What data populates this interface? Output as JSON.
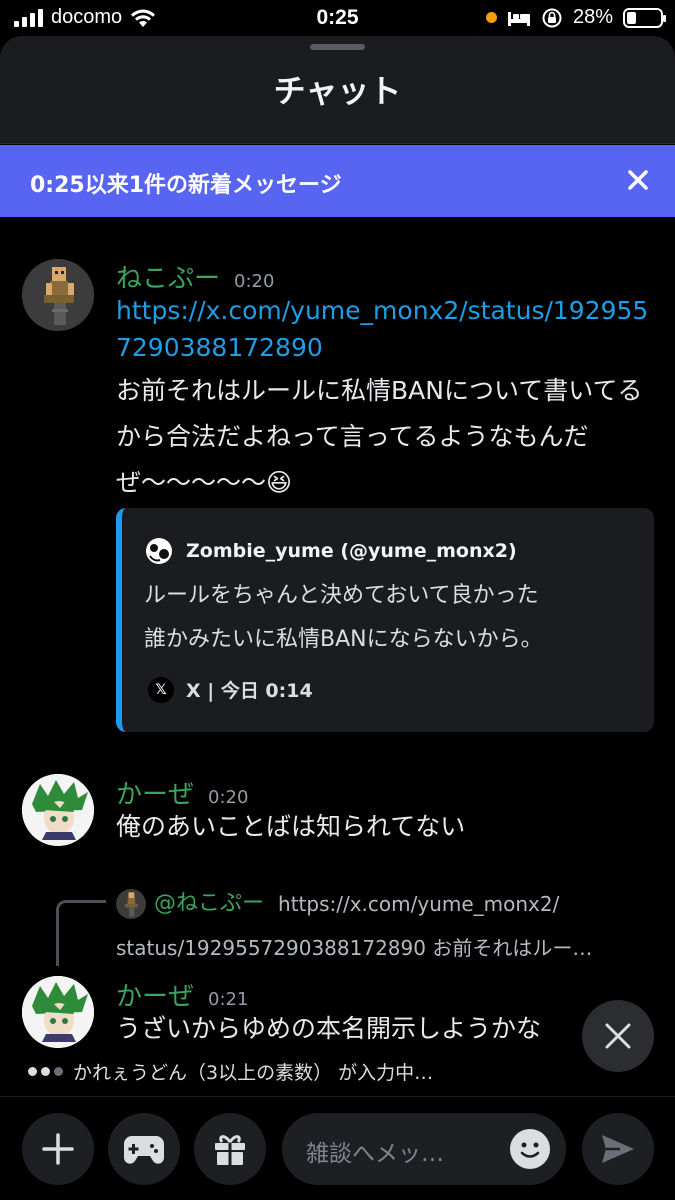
{
  "status_bar": {
    "carrier": "docomo",
    "time": "0:25",
    "battery": "28%"
  },
  "header": {
    "title": "チャット"
  },
  "banner": {
    "text": "0:25以来1件の新着メッセージ"
  },
  "messages": [
    {
      "author": "ねこぷー",
      "time": "0:20",
      "link": "https://x.com/yume_monx2/status/1929557290388172890",
      "text": "お前それはルールに私情BANについて書いてるから合法だよねって言ってるようなもんだぜ〜〜〜〜〜😆",
      "embed": {
        "author": "Zombie_yume (@yume_monx2)",
        "description_line1": "ルールをちゃんと決めておいて良かった",
        "description_line2": "誰かみたいに私情BANにならないから。",
        "footer": "X | 今日 0:14"
      }
    },
    {
      "author": "かーぜ",
      "time": "0:20",
      "text": "俺のあいことばは知られてない"
    },
    {
      "reply": {
        "author": "@ねこぷー",
        "text_line1": "https://x.com/yume_monx2/",
        "text_line2": "status/1929557290388172890 お前それはルー…"
      },
      "author": "かーぜ",
      "time": "0:21",
      "text": "うざいからゆめの本名開示しようかな"
    }
  ],
  "typing": "かれぇうどん（3以上の素数） が入力中…",
  "input": {
    "placeholder": "雑談へメッ…"
  }
}
